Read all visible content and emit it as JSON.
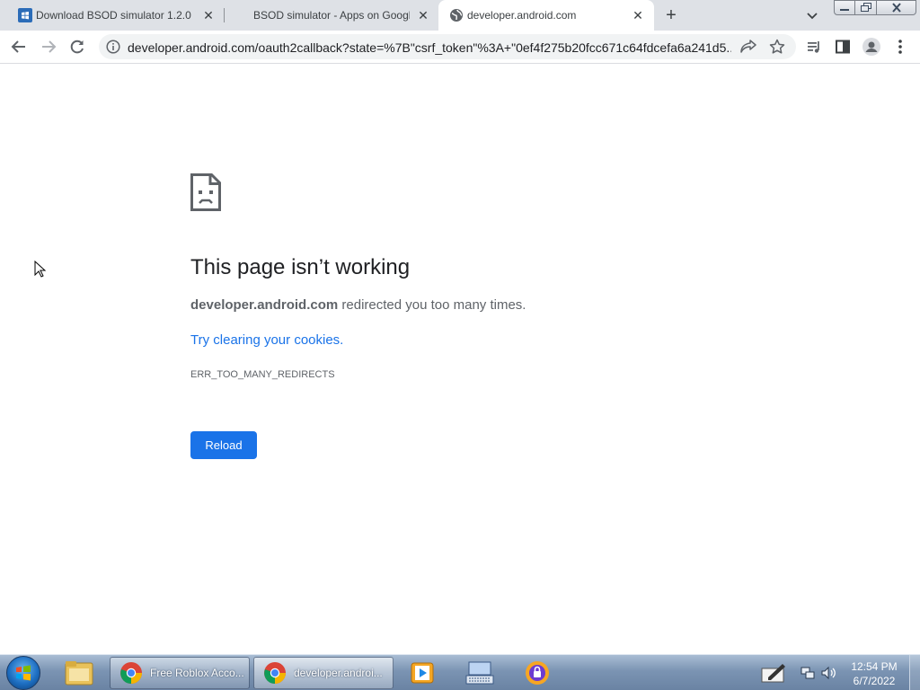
{
  "tabs": [
    {
      "title": "Download BSOD simulator 1.2.0",
      "active": false
    },
    {
      "title": "BSOD simulator - Apps on Google Play",
      "active": false
    },
    {
      "title": "developer.android.com",
      "active": true
    }
  ],
  "tab_icons": [
    "windows-favicon",
    "play-favicon",
    "globe-favicon"
  ],
  "new_tab_symbol": "+",
  "close_symbol": "✕",
  "toolbar": {
    "url": "developer.android.com/oauth2callback?state=%7B\"csrf_token\"%3A+\"0ef4f275b20fcc671c64fdcefa6a241d5..."
  },
  "error": {
    "title": "This page isn’t working",
    "host": "developer.android.com",
    "summary_rest": " redirected you too many times.",
    "suggestion": "Try clearing your cookies.",
    "code": "ERR_TOO_MANY_REDIRECTS",
    "reload_label": "Reload"
  },
  "taskbar": {
    "buttons": [
      {
        "label": "Free Roblox Acco...",
        "active": false
      },
      {
        "label": "developer.androi...",
        "active": true
      }
    ],
    "clock_time": "12:54 PM",
    "clock_date": "6/7/2022"
  },
  "colors": {
    "accent": "#1a73e8",
    "tabstrip": "#dee1e6",
    "omnibox": "#f1f3f4"
  }
}
